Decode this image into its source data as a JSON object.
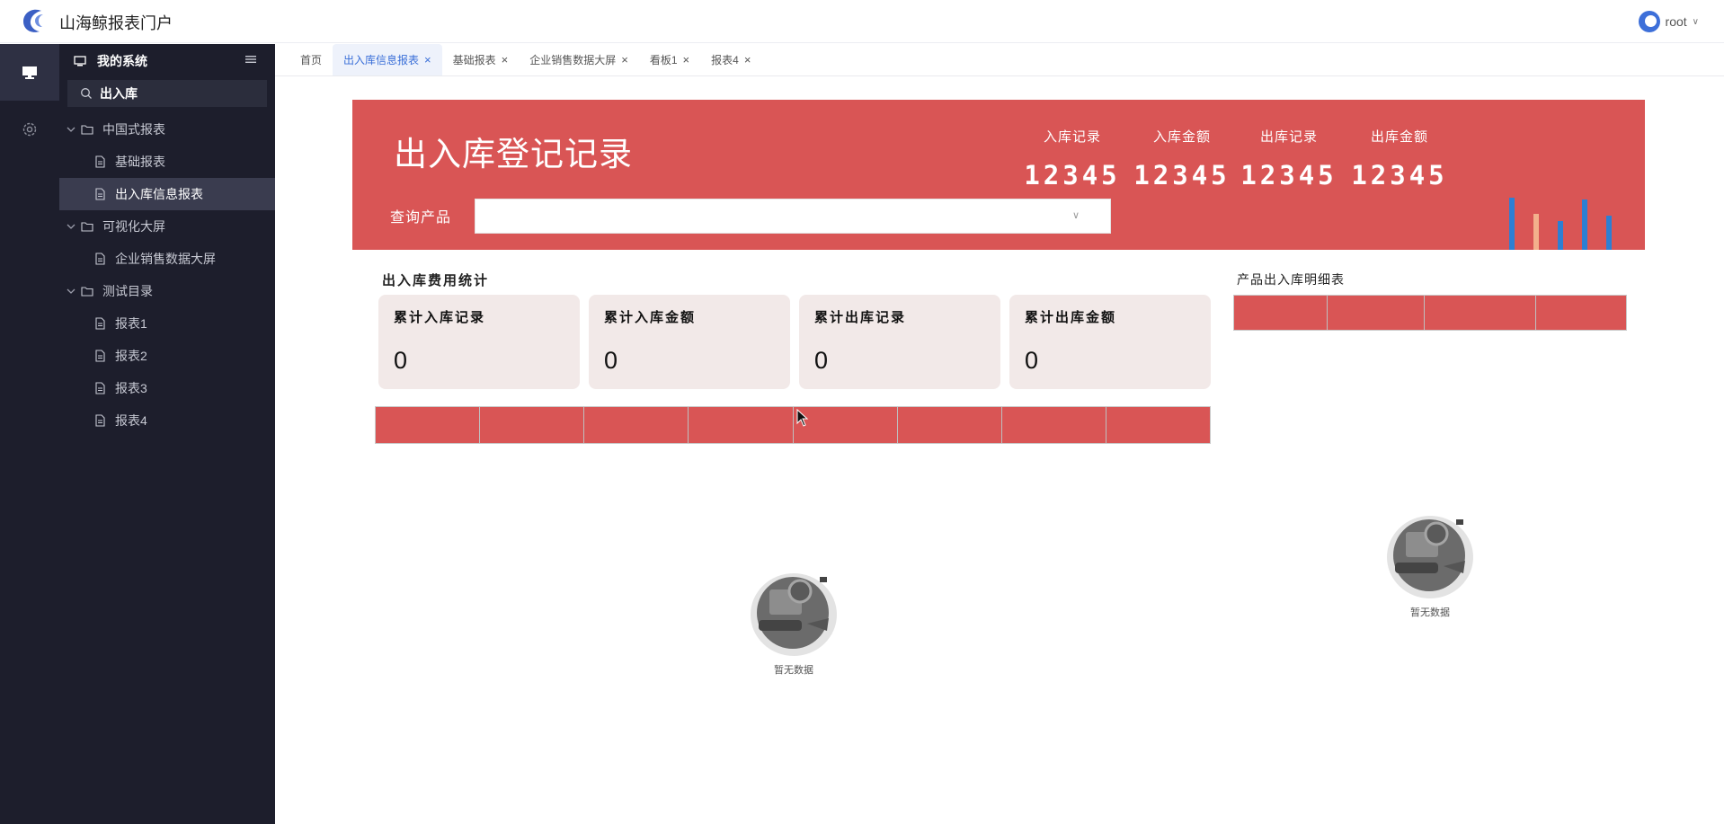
{
  "header": {
    "app_title": "山海鲸报表门户",
    "user_name": "root"
  },
  "sidebar": {
    "system_title": "我的系统",
    "search_value": "出入库",
    "tree": [
      {
        "type": "folder",
        "label": "中国式报表"
      },
      {
        "type": "leaf",
        "label": "基础报表"
      },
      {
        "type": "leaf",
        "label": "出入库信息报表",
        "selected": true
      },
      {
        "type": "folder",
        "label": "可视化大屏"
      },
      {
        "type": "leaf",
        "label": "企业销售数据大屏"
      },
      {
        "type": "folder",
        "label": "测试目录"
      },
      {
        "type": "leaf",
        "label": "报表1"
      },
      {
        "type": "leaf",
        "label": "报表2"
      },
      {
        "type": "leaf",
        "label": "报表3"
      },
      {
        "type": "leaf",
        "label": "报表4"
      }
    ]
  },
  "tabs": [
    {
      "label": "首页",
      "closable": false,
      "active": false
    },
    {
      "label": "出入库信息报表",
      "closable": true,
      "active": true
    },
    {
      "label": "基础报表",
      "closable": true,
      "active": false
    },
    {
      "label": "企业销售数据大屏",
      "closable": true,
      "active": false
    },
    {
      "label": "看板1",
      "closable": true,
      "active": false
    },
    {
      "label": "报表4",
      "closable": true,
      "active": false
    }
  ],
  "banner": {
    "title": "出入库登记记录",
    "query_label": "查询产品",
    "query_value": "",
    "stats": [
      {
        "label": "入库记录",
        "value": "12345"
      },
      {
        "label": "入库金额",
        "value": "12345"
      },
      {
        "label": "出库记录",
        "value": "12345"
      },
      {
        "label": "出库金额",
        "value": "12345"
      }
    ],
    "mini_bars_colors": [
      "#2d7fd3",
      "#f3b08c",
      "#2d7fd3",
      "#2d7fd3",
      "#2d7fd3"
    ]
  },
  "fee_stats": {
    "title": "出入库费用统计",
    "cards": [
      {
        "label": "累计入库记录",
        "value": "0"
      },
      {
        "label": "累计入库金额",
        "value": "0"
      },
      {
        "label": "累计出库记录",
        "value": "0"
      },
      {
        "label": "累计出库金额",
        "value": "0"
      }
    ],
    "empty_text": "暂无数据"
  },
  "detail_table": {
    "title": "产品出入库明细表",
    "empty_text": "暂无数据"
  },
  "colors": {
    "accent_red": "#d95555",
    "sidebar_bg": "#1d1e2c",
    "active_tab": "#3a6fd8"
  }
}
